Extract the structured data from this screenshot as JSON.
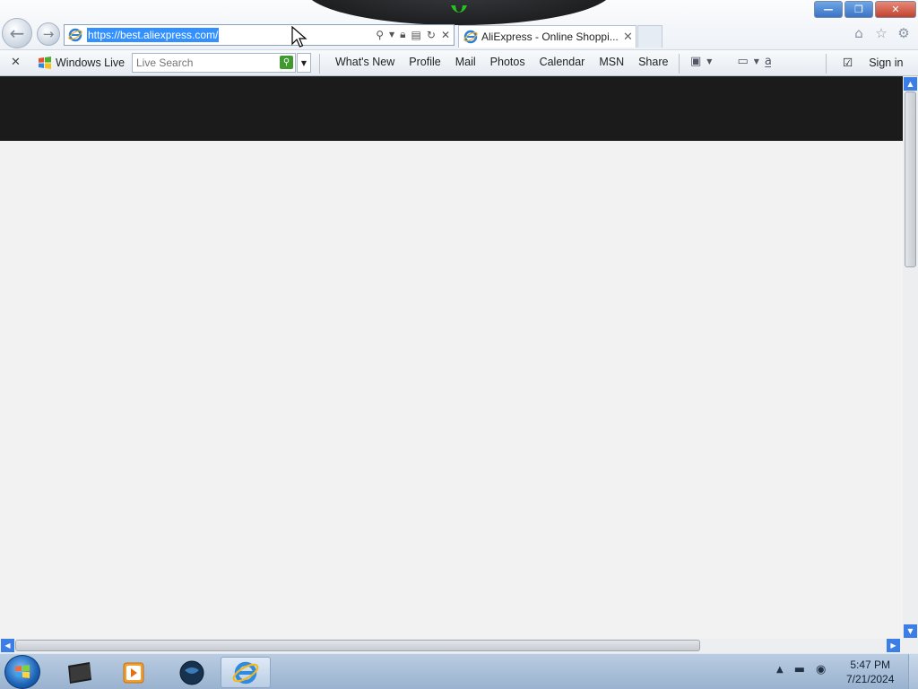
{
  "browser": {
    "address_url": "https://best.aliexpress.com/",
    "tab_title": "AliExpress - Online Shoppi...",
    "tab_close": "✕"
  },
  "window": {
    "minimize": "—",
    "maximize": "❐",
    "close": "✕"
  },
  "toolbar": {
    "close_label": "✕",
    "windows_live": "Windows Live",
    "search_placeholder": "Live Search",
    "links": [
      "What's New",
      "Profile",
      "Mail",
      "Photos",
      "Calendar",
      "MSN",
      "Share"
    ],
    "sign_in": "Sign in"
  },
  "taskbar": {
    "time": "5:47 PM",
    "date": "7/21/2024"
  },
  "icons": {
    "home": "home-icon",
    "favorites": "star-icon",
    "tools": "gear-icon"
  }
}
